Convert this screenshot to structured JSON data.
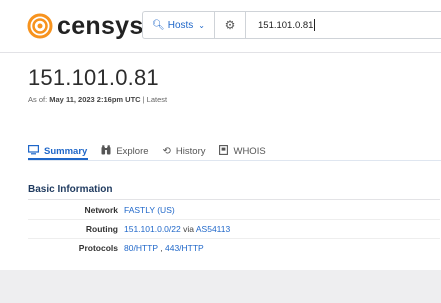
{
  "brand": {
    "name": "censys"
  },
  "search": {
    "scope_label": "Hosts",
    "query": "151.101.0.81"
  },
  "host": {
    "ip": "151.101.0.81",
    "as_of_prefix": "As of: ",
    "as_of_date": "May 11, 2023 2:16pm UTC",
    "as_of_suffix": " | Latest"
  },
  "tabs": [
    {
      "label": "Summary",
      "icon": "monitor-icon",
      "active": true
    },
    {
      "label": "Explore",
      "icon": "binoculars-icon",
      "active": false
    },
    {
      "label": "History",
      "icon": "history-icon",
      "active": false
    },
    {
      "label": "WHOIS",
      "icon": "document-icon",
      "active": false
    }
  ],
  "basic_info": {
    "title": "Basic Information",
    "network_key": "Network",
    "network_value": "FASTLY (US)",
    "routing_key": "Routing",
    "routing_prefix": "151.101.0.0/22",
    "routing_via": "via",
    "routing_asn": "AS54113",
    "protocols_key": "Protocols",
    "protocols": [
      "80/HTTP",
      "443/HTTP"
    ],
    "protocols_sep": ","
  },
  "colors": {
    "accent": "#1f67c9",
    "logo_orange": "#f7931e"
  }
}
